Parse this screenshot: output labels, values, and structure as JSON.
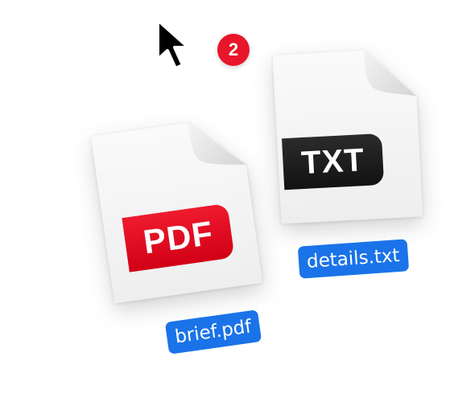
{
  "drag": {
    "cursor_icon": "arrow-cursor-icon",
    "item_count": "2",
    "badge_color": "#e8152b"
  },
  "files": [
    {
      "name": "brief.pdf",
      "type_label": "PDF",
      "icon": "pdf-file-icon",
      "tag_color": "#e0041d"
    },
    {
      "name": "details.txt",
      "type_label": "TXT",
      "icon": "txt-file-icon",
      "tag_color": "#1a1a1a"
    }
  ],
  "label_color": "#1a73e8"
}
